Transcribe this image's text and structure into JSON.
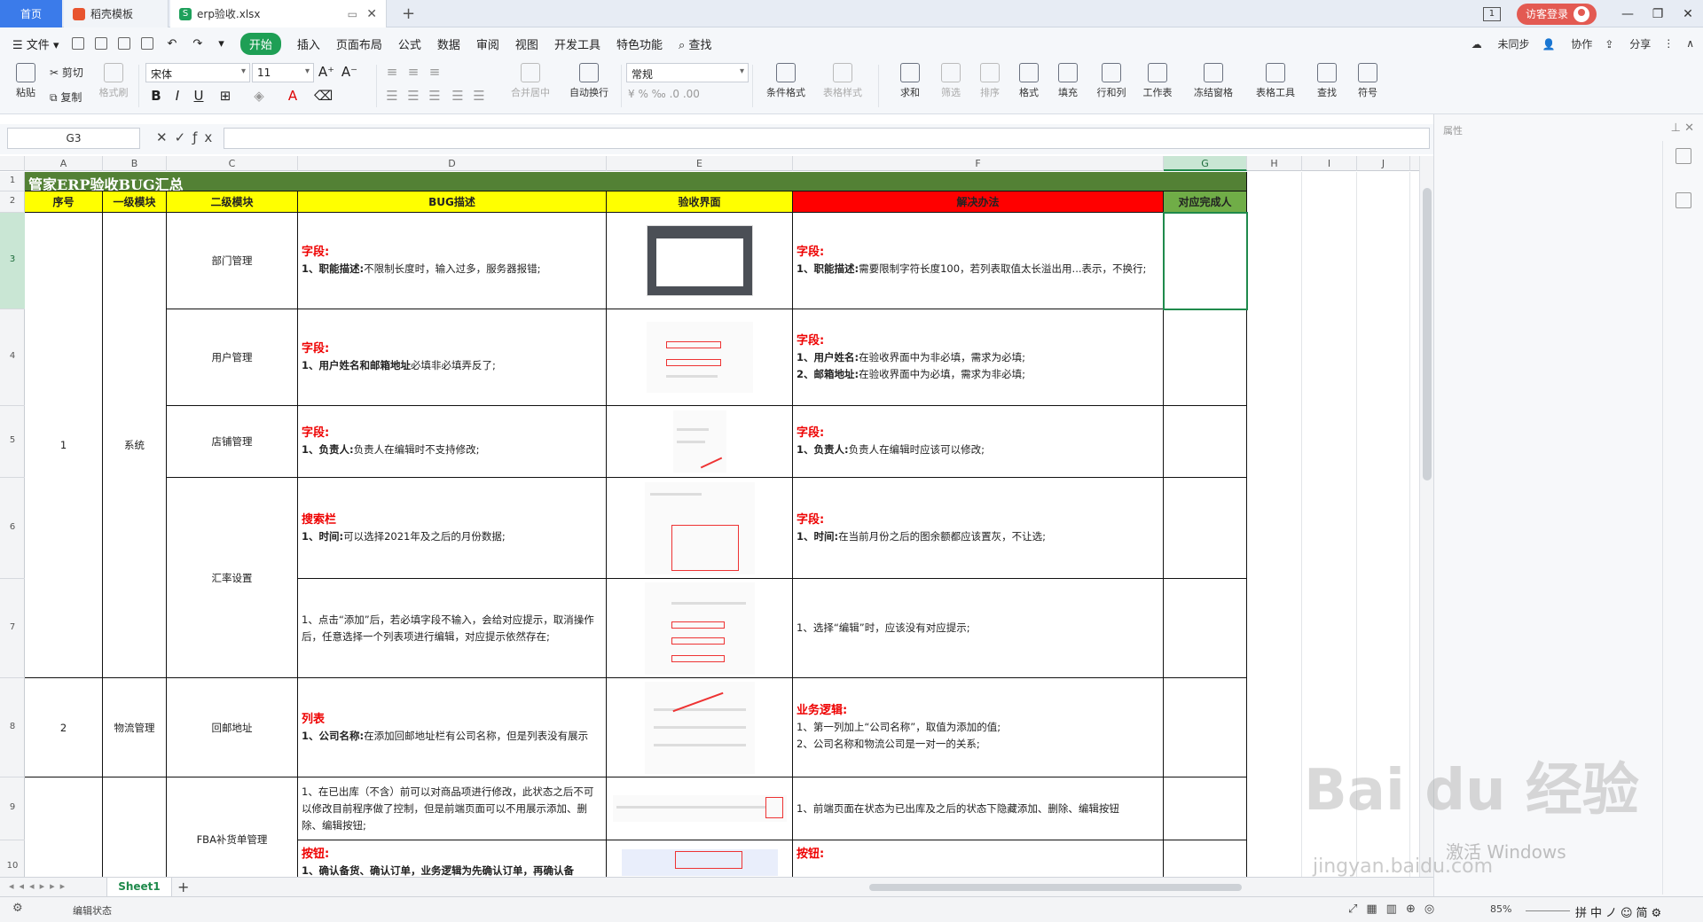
{
  "tabs": {
    "home": "首页",
    "template": "稻壳模板",
    "file": "erp验收.xlsx"
  },
  "login": "访客登录",
  "menu": {
    "file": "文件",
    "start": "开始",
    "insert": "插入",
    "page_layout": "页面布局",
    "formula": "公式",
    "data": "数据",
    "review": "审阅",
    "view": "视图",
    "developer": "开发工具",
    "special": "特色功能",
    "search": "查找",
    "sync": "未同步",
    "collab": "协作",
    "share": "分享"
  },
  "ribbon": {
    "paste": "粘贴",
    "cut": "剪切",
    "copy": "复制",
    "format_painter": "格式刷",
    "font_name": "宋体",
    "font_size": "11",
    "merge": "合并居中",
    "wrap": "自动换行",
    "number_format": "常规",
    "cond_format": "条件格式",
    "table_style": "表格样式",
    "sum": "求和",
    "filter": "筛选",
    "sort": "排序",
    "format": "格式",
    "fill": "填充",
    "rowcol": "行和列",
    "worksheet": "工作表",
    "freeze": "冻结窗格",
    "table_tools": "表格工具",
    "find": "查找",
    "symbol": "符号"
  },
  "name_box": "G3",
  "columns": [
    "A",
    "B",
    "C",
    "D",
    "E",
    "F",
    "G",
    "H",
    "I",
    "J"
  ],
  "rows": [
    "1",
    "2",
    "3",
    "4",
    "5",
    "6",
    "7",
    "8",
    "9",
    "10"
  ],
  "sheet": {
    "title": "管家ERP验收BUG汇总",
    "headers": [
      "序号",
      "一级模块",
      "二级模块",
      "BUG描述",
      "验收界面",
      "解决办法",
      "对应完成人"
    ],
    "r1": {
      "seq": "1",
      "module": "系统"
    },
    "r2": {
      "seq": "2",
      "module": "物流管理",
      "sub": "回邮地址"
    },
    "sub": {
      "dept": "部门管理",
      "user": "用户管理",
      "store": "店铺管理",
      "rate": "汇率设置",
      "fba": "FBA补货单管理"
    },
    "r3": {
      "desc_h": "字段:",
      "desc_b": "1、职能描述:",
      "desc_t": "不限制长度时，输入过多，服务器报错;",
      "sol_h": "字段:",
      "sol_b": "1、职能描述:",
      "sol_t": "需要限制字符长度100，若列表取值太长溢出用...表示，不换行;"
    },
    "r4": {
      "desc_h": "字段:",
      "desc_b": "1、用户姓名和邮箱地址",
      "desc_t": "必填非必填弄反了;",
      "sol_h": "字段:",
      "sol_b1": "1、用户姓名:",
      "sol_t1": "在验收界面中为非必填，需求为必填;",
      "sol_b2": "2、邮箱地址:",
      "sol_t2": "在验收界面中为必填，需求为非必填;"
    },
    "r5": {
      "desc_h": "字段:",
      "desc_b": "1、负责人:",
      "desc_t": "负责人在编辑时不支持修改;",
      "sol_h": "字段:",
      "sol_b": "1、负责人:",
      "sol_t": "负责人在编辑时应该可以修改;"
    },
    "r6": {
      "desc_h": "搜索栏",
      "desc_b": "1、时间:",
      "desc_t": "可以选择2021年及之后的月份数据;",
      "sol_h": "字段:",
      "sol_b": "1、时间:",
      "sol_t": "在当前月份之后的图余额都应该置灰，不让选;"
    },
    "r7": {
      "desc": "1、点击“添加”后，若必填字段不输入，会给对应提示，取消操作后，任意选择一个列表项进行编辑，对应提示依然存在;",
      "sol": "1、选择“编辑”时，应该没有对应提示;"
    },
    "r8": {
      "desc_h": "列表",
      "desc_b": "1、公司名称:",
      "desc_t": "在添加回邮地址栏有公司名称，但是列表没有展示",
      "sol_h": "业务逻辑:",
      "sol_t1": "1、第一列加上“公司名称”，取值为添加的值;",
      "sol_t2": "2、公司名称和物流公司是一对一的关系;"
    },
    "r9": {
      "desc": "1、在已出库（不含）前可以对商品项进行修改，此状态之后不可以修改目前程序做了控制，但是前端页面可以不用展示添加、删除、编辑按钮;",
      "sol": "1、前端页面在状态为已出库及之后的状态下隐藏添加、删除、编辑按钮"
    },
    "r10": {
      "desc_h": "按钮:",
      "desc_t": "1、确认备货、确认订单，业务逻辑为先确认订单，再确认备",
      "sol_h": "按钮:"
    }
  },
  "sheet_tab": "Sheet1",
  "pane_title": "属性",
  "status": {
    "text": "编辑状态",
    "zoom": "85%",
    "ime": "拼中ノ☺简⚙"
  },
  "watermark": {
    "brand": "Bai du 经验",
    "url": "jingyan.baidu.com",
    "activate": "激活 Windows"
  },
  "colors": {
    "title_bg": "#538135",
    "header_yellow": "#ffff00",
    "header_red": "#ff0000",
    "header_green": "#70ad47",
    "accent": "#1e9f55"
  }
}
